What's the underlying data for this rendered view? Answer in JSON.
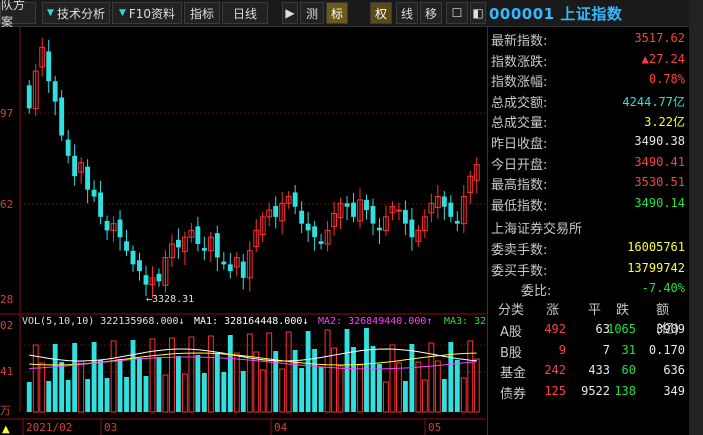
{
  "toolbar": {
    "items": [
      {
        "label": "队方案",
        "arrow": false
      },
      {
        "label": "技术分析",
        "arrow": true
      },
      {
        "label": "F10资料",
        "arrow": true
      },
      {
        "label": "指标",
        "arrow": false
      },
      {
        "label": "日线",
        "arrow": false
      },
      {
        "label": "▶",
        "arrow": false
      },
      {
        "label": "测",
        "arrow": false
      },
      {
        "label": "标",
        "arrow": false
      },
      {
        "label": "权",
        "arrow": false
      },
      {
        "label": "线",
        "arrow": false
      },
      {
        "label": "移",
        "arrow": false
      },
      {
        "label": "☐",
        "arrow": false
      },
      {
        "label": "◧",
        "arrow": false
      }
    ]
  },
  "title": "000001 上证指数",
  "quote": [
    {
      "k": "最新指数:",
      "v": "3517.62",
      "c": "red"
    },
    {
      "k": "指数涨跌:",
      "v": "▲27.24",
      "c": "red"
    },
    {
      "k": "指数涨幅:",
      "v": "0.78%",
      "c": "red"
    },
    {
      "k": "总成交额:",
      "v": "4244.77亿",
      "c": "cy"
    },
    {
      "k": "总成交量:",
      "v": "3.22亿",
      "c": "yel"
    },
    {
      "k": "昨日收盘:",
      "v": "3490.38",
      "c": "wh"
    },
    {
      "k": "今日开盘:",
      "v": "3490.41",
      "c": "red"
    },
    {
      "k": "最高指数:",
      "v": "3530.51",
      "c": "red"
    },
    {
      "k": "最低指数:",
      "v": "3490.14",
      "c": "grn"
    }
  ],
  "exchange": "上海证券交易所",
  "orders": [
    {
      "k": "委卖手数:",
      "v": "16005761",
      "c": "yel"
    },
    {
      "k": "委买手数:",
      "v": "13799742",
      "c": "yel"
    },
    {
      "k": "委比:",
      "v": "-7.40%",
      "c": "grn"
    }
  ],
  "stats": {
    "header": [
      "分类",
      "涨",
      "平",
      "跌",
      "额(亿)"
    ],
    "rows": [
      [
        "A股",
        "492",
        "63",
        "1065",
        "3909"
      ],
      [
        "B股",
        "9",
        "7",
        "31",
        "0.170"
      ],
      [
        "基金",
        "242",
        "433",
        "60",
        "636"
      ],
      [
        "债券",
        "125",
        "9522",
        "138",
        "349"
      ]
    ]
  },
  "vol_header": {
    "vol": "VOL(5,10,10) 322135968.000↓",
    "ma1": "MA1: 328164448.000↓",
    "ma2": "MA2: 326849440.000↑",
    "ma3": "MA3: 32"
  },
  "chart_data": {
    "type": "candlestick",
    "y_ticks": [
      "97",
      "62",
      "28"
    ],
    "vol_ticks": [
      "02",
      "41"
    ],
    "x_ticks": [
      "2021/02",
      "03",
      "04",
      "05"
    ],
    "low_annotation": "←3328.31",
    "unit_label": "万"
  }
}
